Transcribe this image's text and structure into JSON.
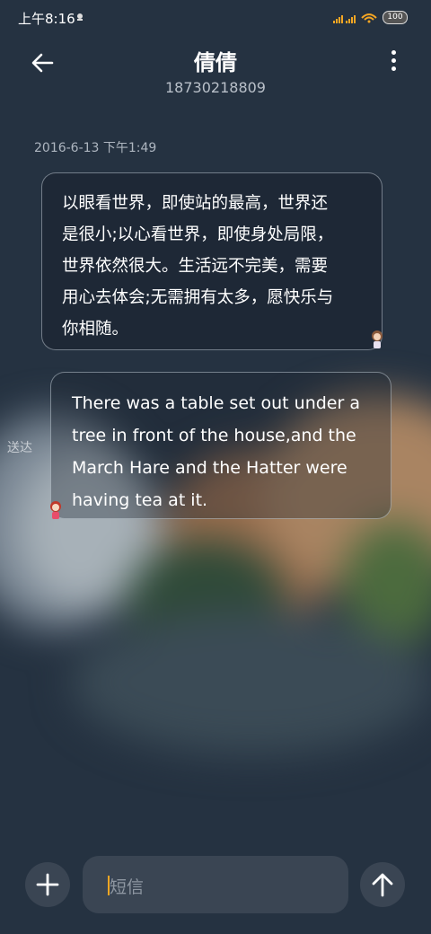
{
  "status_bar": {
    "time": "上午8:16",
    "battery": "100"
  },
  "header": {
    "contact_name": "倩倩",
    "phone_number": "18730218809"
  },
  "conversation": {
    "timestamp": "2016-6-13 下午1:49",
    "messages": [
      {
        "direction": "incoming",
        "lines": [
          "以眼看世界，即使站的最高，世界还",
          "是很小;以心看世界，即使身处局限，",
          "世界依然很大。生活远不完美，需要",
          "用心去体会;无需拥有太多，愿快乐与",
          "你相随。"
        ]
      },
      {
        "direction": "outgoing",
        "lines": [
          "There was a table set out under a",
          "tree in front of the house,and the",
          "March Hare and the Hatter were",
          "having tea at it."
        ],
        "status": "送达"
      }
    ]
  },
  "composer": {
    "placeholder": "短信"
  },
  "icons": {
    "back": "arrow-left-icon",
    "more": "more-vertical-icon",
    "add": "plus-icon",
    "send": "arrow-up-icon"
  },
  "colors": {
    "background": "#253241",
    "accent_cursor": "#f5a623",
    "control_bg": "#3a4553"
  }
}
